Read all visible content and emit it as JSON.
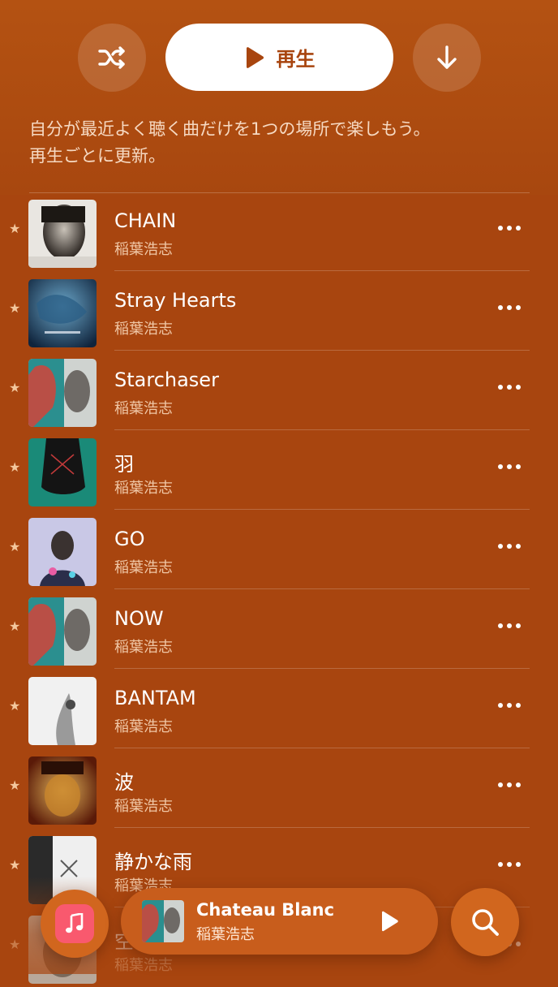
{
  "controls": {
    "shuffle_icon": "shuffle-icon",
    "play_label": "再生",
    "download_icon": "download-icon"
  },
  "description": {
    "line1": "自分が最近よく聴く曲だけを1つの場所で楽しもう。",
    "line2": "再生ごとに更新。"
  },
  "tracks": [
    {
      "title": "CHAIN",
      "artist": "稲葉浩志",
      "favorite": true
    },
    {
      "title": "Stray Hearts",
      "artist": "稲葉浩志",
      "favorite": true
    },
    {
      "title": "Starchaser",
      "artist": "稲葉浩志",
      "favorite": true
    },
    {
      "title": "羽",
      "artist": "稲葉浩志",
      "favorite": true
    },
    {
      "title": "GO",
      "artist": "稲葉浩志",
      "favorite": true
    },
    {
      "title": "NOW",
      "artist": "稲葉浩志",
      "favorite": true
    },
    {
      "title": "BANTAM",
      "artist": "稲葉浩志",
      "favorite": true
    },
    {
      "title": "波",
      "artist": "稲葉浩志",
      "favorite": true
    },
    {
      "title": "静かな雨",
      "artist": "稲葉浩志",
      "favorite": true
    },
    {
      "title": "空",
      "artist": "稲葉浩志",
      "favorite": true
    }
  ],
  "star_glyph": "★",
  "now_playing": {
    "title": "Chateau Blanc",
    "artist": "稲葉浩志"
  },
  "colors": {
    "background": "#a8450f",
    "accent": "#a8450f",
    "star": "#f3c79d",
    "music_app_red": "#f9596e"
  }
}
